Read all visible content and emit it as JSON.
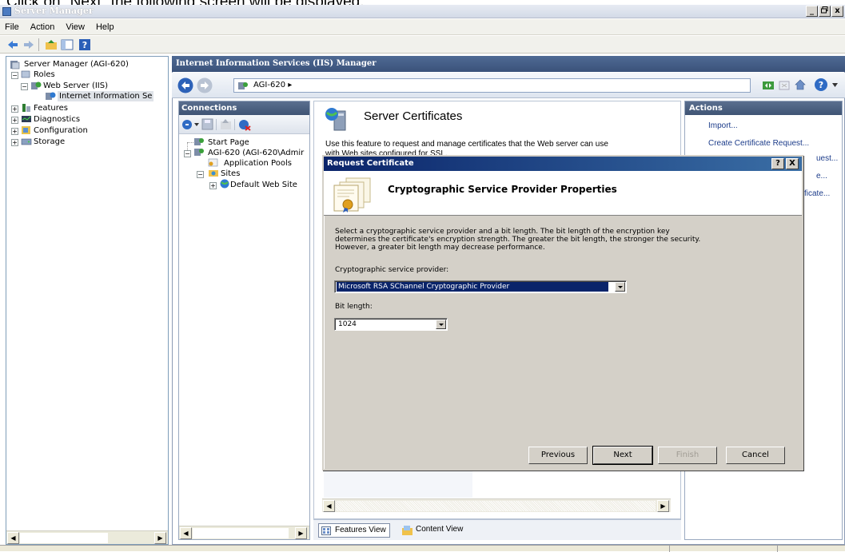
{
  "caption": "Click on \"Next\" the following screen will be displayed.",
  "window": {
    "title": "Server Manager",
    "buttons": [
      "_",
      " ",
      "x"
    ]
  },
  "menu": [
    "File",
    "Action",
    "View",
    "Help"
  ],
  "left_tree": {
    "root": "Server Manager (AGI-620)",
    "roles": "Roles",
    "web_server": "Web Server (IIS)",
    "iis": "Internet Information Se",
    "features": "Features",
    "diagnostics": "Diagnostics",
    "configuration": "Configuration",
    "storage": "Storage"
  },
  "iis": {
    "header": "Internet Information Services (IIS) Manager",
    "address": "AGI-620 ▸"
  },
  "connections": {
    "header": "Connections",
    "start_page": "Start Page",
    "server": "AGI-620 (AGI-620\\Admir",
    "app_pools": "Application Pools",
    "sites": "Sites",
    "default_site": "Default Web Site"
  },
  "main": {
    "title": "Server Certificates",
    "description": "Use this feature to request and manage certificates that the Web server can use",
    "description2": "with Web sites configured for SSL.",
    "features_view": "Features View",
    "content_view": "Content View"
  },
  "actions": {
    "header": "Actions",
    "items": [
      "Import...",
      "Create Certificate Request...",
      "uest...",
      "e...",
      "ficate..."
    ]
  },
  "dialog": {
    "title": "Request Certificate",
    "heading": "Cryptographic Service Provider Properties",
    "intro1": "Select a cryptographic service provider and a bit length. The bit length of the encryption key",
    "intro2": "determines the certificate's encryption strength. The greater the bit length, the stronger the security.",
    "intro3": "However, a greater bit length may decrease performance.",
    "provider_label": "Cryptographic service provider:",
    "provider_value": "Microsoft RSA SChannel Cryptographic Provider",
    "bitlength_label": "Bit length:",
    "bitlength_value": "1024",
    "buttons": {
      "previous": "Previous",
      "next": "Next",
      "finish": "Finish",
      "cancel": "Cancel"
    },
    "help_glyph": "?",
    "close_glyph": "X"
  },
  "colors": {
    "dialog_title": "#0a246a",
    "panel_header": "#3f5474",
    "selection": "#0a246a"
  }
}
